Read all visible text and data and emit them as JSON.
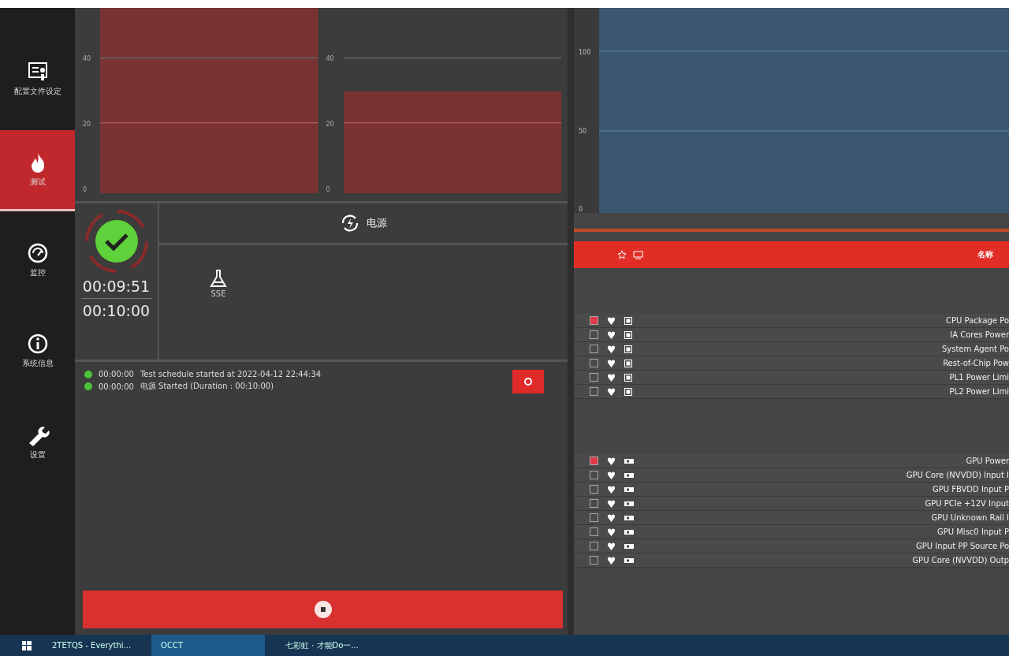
{
  "sidebar": {
    "items": [
      {
        "label": "配置文件设定",
        "kind": "schedule",
        "selected": false
      },
      {
        "label": "测试",
        "kind": "flame",
        "selected": true
      },
      {
        "label": "监控",
        "kind": "gauge",
        "selected": false
      },
      {
        "label": "系统信息",
        "kind": "info",
        "selected": false
      },
      {
        "label": "设置",
        "kind": "wrench",
        "selected": false
      }
    ]
  },
  "charts": [
    {
      "ticks": [
        "40",
        "20",
        "0"
      ]
    },
    {
      "ticks": [
        "40",
        "20",
        "0"
      ]
    }
  ],
  "test": {
    "name": "电源",
    "passed": true,
    "elapsed": "00:09:51",
    "duration": "00:10:00",
    "instruction": "SSE"
  },
  "log": {
    "entries": [
      {
        "time": "00:00:00",
        "text": "Test schedule started at 2022-04-12 22:44:34"
      },
      {
        "time": "00:00:00",
        "text": "电源  Started (Duration : 00:10:00)"
      }
    ]
  },
  "monitor": {
    "ticks": [
      "100",
      "50",
      "0"
    ],
    "header": "名称",
    "groups": [
      {
        "kind": "cpu",
        "rows": [
          {
            "name": "CPU Package Po",
            "checked": true
          },
          {
            "name": "IA Cores Power",
            "checked": false
          },
          {
            "name": "System Agent Po",
            "checked": false
          },
          {
            "name": "Rest-of-Chip Pow",
            "checked": false
          },
          {
            "name": "PL1 Power Limi",
            "checked": false
          },
          {
            "name": "PL2 Power Limi",
            "checked": false
          }
        ]
      },
      {
        "kind": "gpu",
        "rows": [
          {
            "name": "GPU Power",
            "checked": true
          },
          {
            "name": "GPU Core (NVVDD) Input I",
            "checked": false
          },
          {
            "name": "GPU FBVDD Input P",
            "checked": false
          },
          {
            "name": "GPU PCIe +12V Input",
            "checked": false
          },
          {
            "name": "GPU Unknown Rail I",
            "checked": false
          },
          {
            "name": "GPU Misc0 Input P",
            "checked": false
          },
          {
            "name": "GPU Input PP Source Po",
            "checked": false
          },
          {
            "name": "GPU Core (NVVDD) Outp",
            "checked": false
          }
        ]
      }
    ]
  },
  "taskbar": {
    "items": [
      {
        "label": "2TETQS - Everythi...",
        "active": false
      },
      {
        "label": "OCCT",
        "active": true
      },
      {
        "label": "七彩虹 · 才能Do一...",
        "active": false
      }
    ]
  }
}
